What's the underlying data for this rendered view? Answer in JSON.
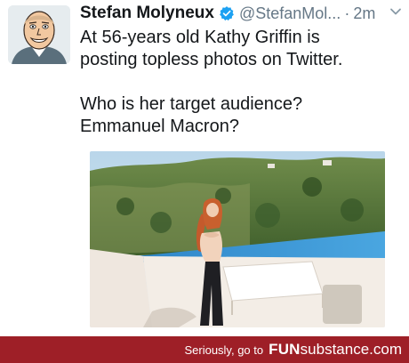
{
  "tweet": {
    "display_name": "Stefan Molyneux",
    "handle": "@StefanMol...",
    "separator": "·",
    "timestamp": "2m",
    "text_lines": [
      "At 56-years old Kathy Griffin is",
      "posting topless photos on Twitter.",
      "",
      "Who is her target audience?",
      "Emmanuel Macron?"
    ]
  },
  "icons": {
    "verified": "verified-badge-icon",
    "chevron": "chevron-down-icon"
  },
  "colors": {
    "verified_blue": "#1da1f2",
    "secondary_text": "#657786",
    "footer_red": "#9e1f27"
  },
  "watermark": {
    "prefix": "Seriously, go to",
    "brand_bold": "FUN",
    "brand_regular": "substance",
    "brand_suffix": ".com"
  }
}
